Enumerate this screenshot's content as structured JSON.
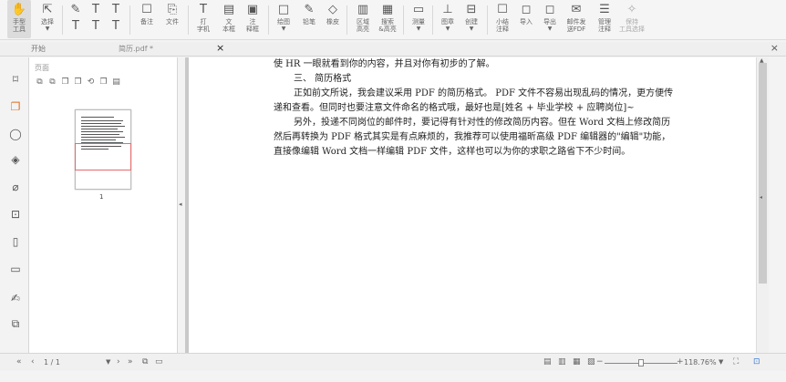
{
  "toolbar": {
    "tools": [
      {
        "label": "手型\n工具",
        "icon": "hand-icon",
        "glyph": "✋"
      },
      {
        "label": "选择",
        "icon": "cursor-icon",
        "glyph": "⇱"
      },
      {
        "label": "",
        "icon": "pencil-icon",
        "glyph": "✎"
      },
      {
        "label": "",
        "icon": "text-icon",
        "glyph": "T"
      },
      {
        "label": "",
        "icon": "text-icon",
        "glyph": "T"
      },
      {
        "label": "备注",
        "icon": "comment-icon",
        "glyph": "☐"
      },
      {
        "label": "文件",
        "icon": "file-icon",
        "glyph": "⎘"
      },
      {
        "label": "打\n字机",
        "icon": "typewriter-icon",
        "glyph": "T"
      },
      {
        "label": "文\n本框",
        "icon": "textbox-icon",
        "glyph": "▤"
      },
      {
        "label": "注\n释框",
        "icon": "callout-icon",
        "glyph": "▣"
      },
      {
        "label": "绘图",
        "icon": "draw-icon",
        "glyph": "□"
      },
      {
        "label": "铅笔",
        "icon": "pencil-icon",
        "glyph": "✎"
      },
      {
        "label": "橡皮",
        "icon": "eraser-icon",
        "glyph": "◇"
      },
      {
        "label": "区域\n高亮",
        "icon": "highlight-icon",
        "glyph": "▥"
      },
      {
        "label": "搜索\n&高亮",
        "icon": "search-highlight-icon",
        "glyph": "▦"
      },
      {
        "label": "测量",
        "icon": "measure-icon",
        "glyph": "▭"
      },
      {
        "label": "图章",
        "icon": "stamp-icon",
        "glyph": "⊥"
      },
      {
        "label": "创建",
        "icon": "create-icon",
        "glyph": "⊟"
      },
      {
        "label": "小结\n注释",
        "icon": "summary-icon",
        "glyph": "☐"
      },
      {
        "label": "导入",
        "icon": "import-icon",
        "glyph": "◻"
      },
      {
        "label": "导出",
        "icon": "export-icon",
        "glyph": "◻"
      },
      {
        "label": "邮件发\n送FDF",
        "icon": "mail-icon",
        "glyph": "✉"
      },
      {
        "label": "管理\n注释",
        "icon": "manage-icon",
        "glyph": "☰"
      },
      {
        "label": "保持\n工具选择",
        "icon": "pin-icon",
        "glyph": "✧"
      }
    ]
  },
  "tabs": {
    "start": "开始",
    "current": "简历.pdf *"
  },
  "rail": {
    "icons": [
      "bookmark-icon",
      "pages-icon",
      "comments-icon",
      "layers-icon",
      "attachment-icon",
      "security-icon",
      "file-info-icon",
      "form-icon",
      "signature-icon",
      "compare-icon"
    ]
  },
  "panel": {
    "title": "页面",
    "page_label": "1"
  },
  "document": {
    "paragraphs": [
      "使 HR 一眼就看到你的内容，并且对你有初步的了解。",
      "三、 简历格式",
      "正如前文所说，我会建议采用 PDF 的简历格式。 PDF 文件不容易出现乱码的情况，更方便传递和查看。但同时也要注意文件命名的格式哦，最好也是[姓名 + 毕业学校 + 应聘岗位]~",
      "另外，投递不同岗位的邮件时，要记得有针对性的修改简历内容。但在 Word 文档上修改简历然后再转换为 PDF 格式其实是有点麻烦的，我推荐可以使用福昕高级 PDF 编辑器的\"编辑\"功能，直接像编辑 Word 文档一样编辑 PDF 文件，这样也可以为你的求职之路省下不少时间。"
    ]
  },
  "status": {
    "page_indicator": "1 / 1",
    "zoom": "118.76%"
  }
}
